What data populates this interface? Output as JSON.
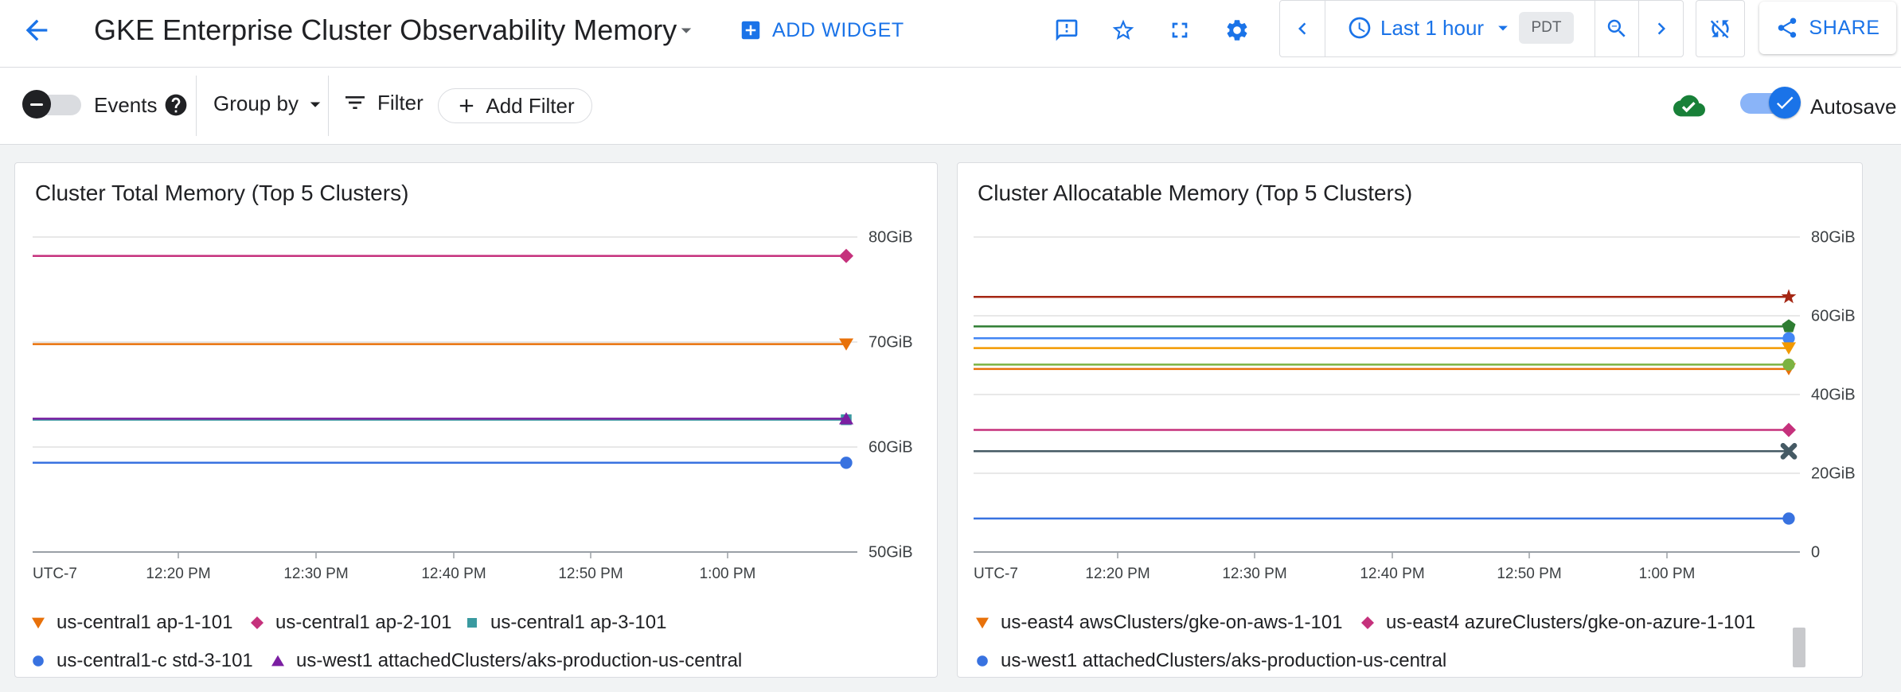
{
  "header": {
    "title": "GKE Enterprise Cluster Observability Memory",
    "add_widget": "ADD WIDGET",
    "time_range": "Last 1 hour",
    "timezone": "PDT",
    "share": "SHARE",
    "accent": "#1a73e8"
  },
  "toolbar": {
    "events_label": "Events",
    "group_by": "Group by",
    "filter": "Filter",
    "add_filter": "Add Filter",
    "autosave": "Autosave",
    "events_enabled": false,
    "autosave_enabled": true
  },
  "panels": [
    {
      "title": "Cluster Total Memory (Top 5 Clusters)",
      "chart_data": {
        "type": "line",
        "x_ticks": [
          "UTC-7",
          "12:20 PM",
          "12:30 PM",
          "12:40 PM",
          "12:50 PM",
          "1:00 PM"
        ],
        "y_ticks": [
          "80GiB",
          "70GiB",
          "60GiB",
          "50GiB"
        ],
        "y_tick_values": [
          80,
          70,
          60,
          50
        ],
        "ylim": [
          50,
          80
        ],
        "y_unit": "GiB",
        "grid": true,
        "series": [
          {
            "name": "us-central1 ap-1-101",
            "marker": "triangle-down",
            "color": "#e8710a",
            "value": 69.8
          },
          {
            "name": "us-central1 ap-2-101",
            "marker": "diamond",
            "color": "#c5317c",
            "value": 78.2
          },
          {
            "name": "us-central1 ap-3-101",
            "marker": "square",
            "color": "#3a9aa0",
            "value": 62.6
          },
          {
            "name": "us-central1-c std-3-101",
            "marker": "circle",
            "color": "#3872e0",
            "value": 58.5
          },
          {
            "name": "us-west1 attachedClusters/aks-production-us-central",
            "marker": "triangle-up",
            "color": "#7b1fa2",
            "value": 62.7
          }
        ]
      }
    },
    {
      "title": "Cluster Allocatable Memory (Top 5 Clusters)",
      "chart_data": {
        "type": "line",
        "x_ticks": [
          "UTC-7",
          "12:20 PM",
          "12:30 PM",
          "12:40 PM",
          "12:50 PM",
          "1:00 PM"
        ],
        "y_ticks": [
          "80GiB",
          "60GiB",
          "40GiB",
          "20GiB",
          "0"
        ],
        "y_tick_values": [
          80,
          60,
          40,
          20,
          0
        ],
        "ylim": [
          0,
          80
        ],
        "y_unit": "GiB",
        "grid": true,
        "series": [
          {
            "name": "us-east4 awsClusters/gke-on-aws-1-101",
            "marker": "triangle-down",
            "color": "#e8710a",
            "value": 46.5
          },
          {
            "name": "us-east4 azureClusters/gke-on-azure-1-101",
            "marker": "diamond",
            "color": "#c5317c",
            "value": 31.0
          },
          {
            "name": "us-west1 attachedClusters/aks-production-us-central",
            "marker": "circle",
            "color": "#3872e0",
            "value": 8.5
          },
          {
            "marker": "star",
            "color": "#a52714",
            "value": 64.8
          },
          {
            "marker": "pentagon",
            "color": "#2e7d32",
            "value": 57.3
          },
          {
            "marker": "circle",
            "color": "#4285f4",
            "value": 54.3
          },
          {
            "marker": "triangle-down",
            "color": "#f29900",
            "value": 51.8
          },
          {
            "marker": "circle",
            "color": "#7cb342",
            "value": 47.6
          },
          {
            "marker": "x",
            "color": "#455a64",
            "value": 25.6
          }
        ]
      }
    }
  ]
}
